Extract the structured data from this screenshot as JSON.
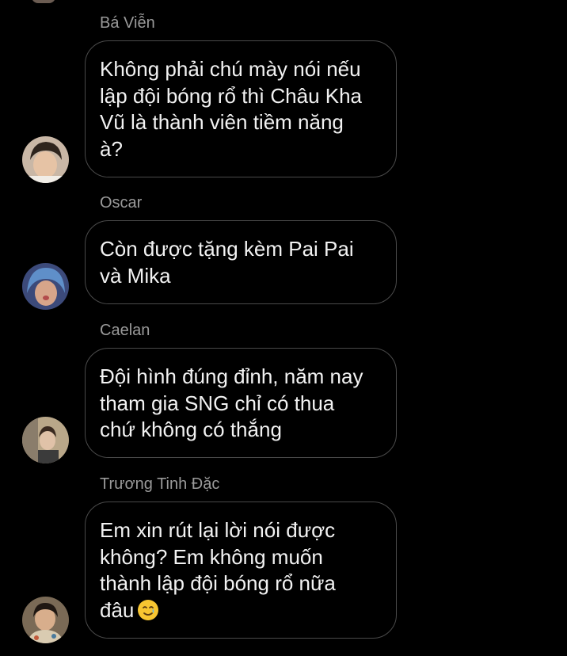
{
  "messages": [
    {
      "sender": "Bá Viễn",
      "text": "Không phải chú mày nói nếu\nlập đội bóng rổ thì Châu Kha\nVũ là thành viên tiềm năng\nà?"
    },
    {
      "sender": "Oscar",
      "text": "Còn được tặng kèm Pai Pai\nvà Mika"
    },
    {
      "sender": "Caelan",
      "text": "Đội hình đúng đỉnh, năm nay\ntham gia SNG chỉ có thua\nchứ không có thắng"
    },
    {
      "sender": "Trương Tinh Đặc",
      "text": "Em xin rút lại lời nói được\nkhông? Em không muốn\nthành lập đội bóng rổ nữa\nđâu",
      "emoji": "smiling-face-with-tear-emoji"
    }
  ],
  "colors": {
    "background": "#000000",
    "bubble_border": "#4a4a4a",
    "text": "#f2f2f2",
    "sender": "#9a9a9a"
  }
}
